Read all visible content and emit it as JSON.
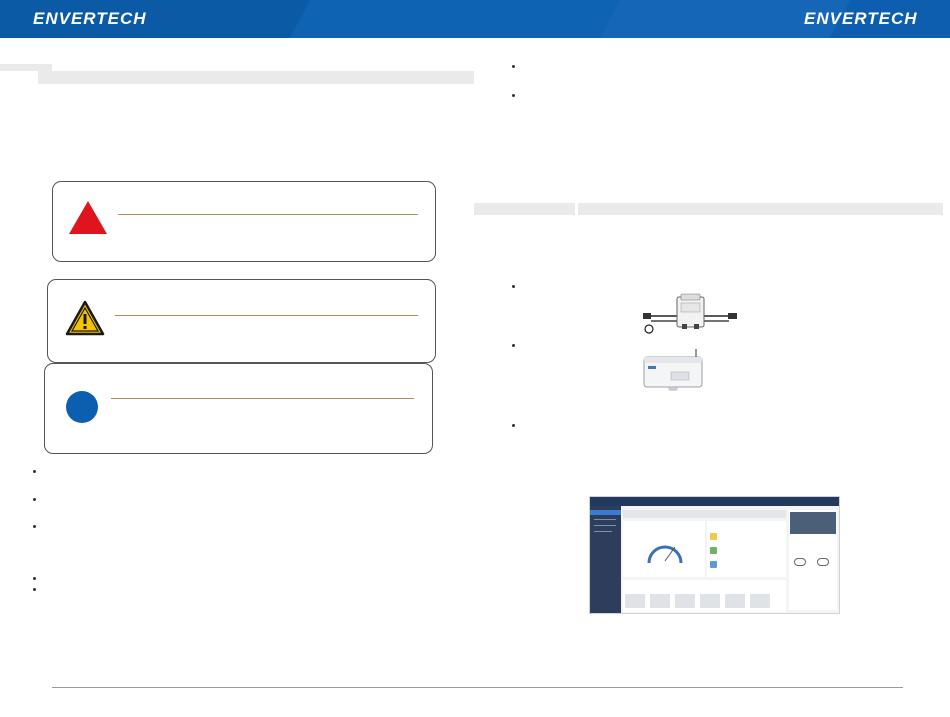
{
  "header": {
    "logo_left": "ENVERTECH",
    "logo_right": "ENVERTECH",
    "colors": {
      "banner": "#0b5fae",
      "banner_light": "#1d74c4",
      "banner_dark": "#074d93"
    }
  },
  "callouts": [
    {
      "icon": "danger-triangle-icon",
      "color": "#e0141e"
    },
    {
      "icon": "warning-triangle-icon",
      "color": "#f5c400"
    },
    {
      "icon": "info-circle-icon",
      "color": "#0b5fae"
    }
  ],
  "products": [
    {
      "icon": "microinverter-image"
    },
    {
      "icon": "envbridge-gateway-image"
    },
    {
      "icon": "monitoring-dashboard-screenshot"
    }
  ]
}
